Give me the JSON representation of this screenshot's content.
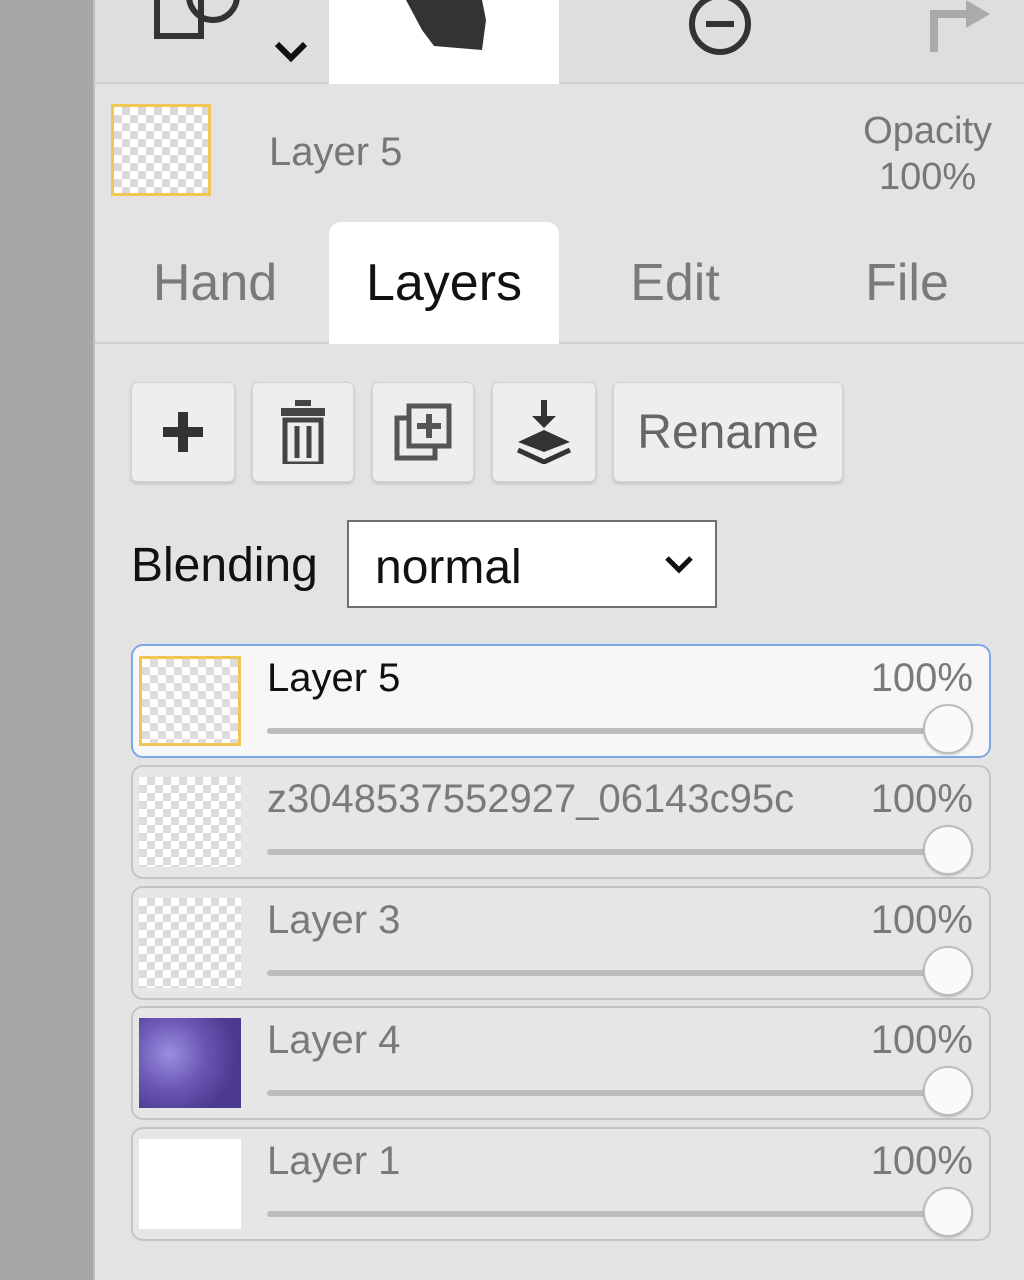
{
  "toolbar": {
    "tools": [
      {
        "icon": "shape-select-icon"
      },
      {
        "icon": "hand-icon"
      },
      {
        "icon": "zoom-out-icon"
      },
      {
        "icon": "redo-icon"
      }
    ]
  },
  "current_layer": {
    "name": "Layer 5",
    "opacity_label": "Opacity",
    "opacity_value": "100%"
  },
  "tabs": [
    {
      "label": "Hand"
    },
    {
      "label": "Layers"
    },
    {
      "label": "Edit"
    },
    {
      "label": "File"
    }
  ],
  "actions": {
    "add_icon": "plus-icon",
    "delete_icon": "trash-icon",
    "duplicate_icon": "duplicate-icon",
    "merge_icon": "merge-down-icon",
    "rename_label": "Rename"
  },
  "blending": {
    "label": "Blending",
    "value": "normal"
  },
  "layers": [
    {
      "name": "Layer 5",
      "opacity": "100%",
      "selected": true
    },
    {
      "name": "z3048537552927_06143c95c",
      "opacity": "100%"
    },
    {
      "name": "Layer 3",
      "opacity": "100%"
    },
    {
      "name": "Layer 4",
      "opacity": "100%"
    },
    {
      "name": "Layer 1",
      "opacity": "100%"
    }
  ],
  "colors": {
    "accent_yellow": "#f0c654",
    "selected_border": "#7ea7e6"
  }
}
